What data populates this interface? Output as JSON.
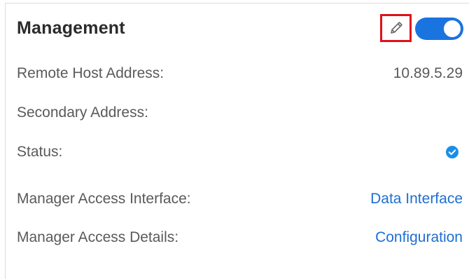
{
  "card": {
    "title": "Management",
    "edit_icon": "pencil-icon",
    "toggle_state": "on",
    "accent_color": "#1a74e0",
    "highlight_color": "#e0111a"
  },
  "rows": [
    {
      "label": "Remote Host Address:",
      "value": "10.89.5.29"
    },
    {
      "label": "Secondary Address:",
      "value": ""
    },
    {
      "label": "Status:",
      "value_icon": "check-circle-icon"
    },
    {
      "label": "Manager Access Interface:",
      "value": "Data Interface"
    },
    {
      "label": "Manager Access Details:",
      "value": "Configuration"
    }
  ]
}
